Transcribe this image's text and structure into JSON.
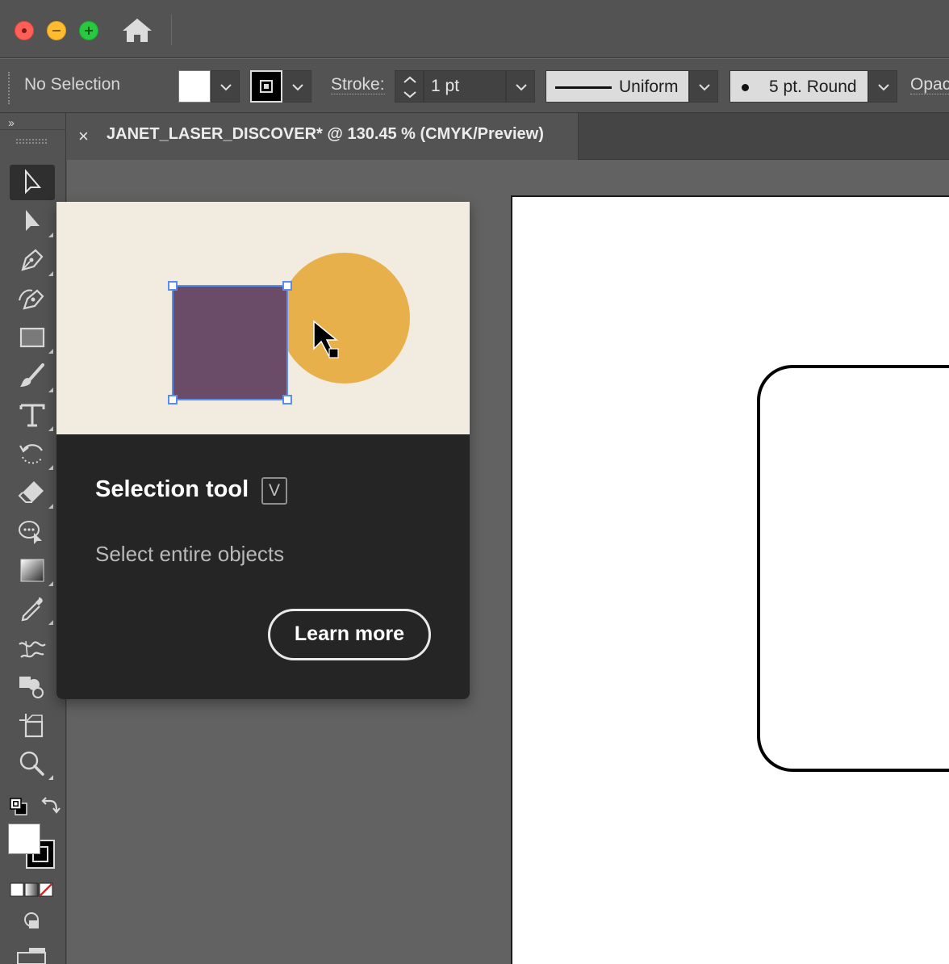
{
  "window": {
    "home_icon": "home-icon"
  },
  "control_bar": {
    "selection_status": "No Selection",
    "fill_color": "#ffffff",
    "stroke_label": "Stroke:",
    "stroke_weight": "1 pt",
    "variable_width_profile": "Uniform",
    "brush_definition": "5 pt. Round",
    "opacity_label": "Opac"
  },
  "document_tab": {
    "close_glyph": "×",
    "title": "JANET_LASER_DISCOVER* @ 130.45 % (CMYK/Preview)"
  },
  "toolbar": {
    "collapse_glyph": "››",
    "tools": [
      {
        "name": "selection-tool",
        "icon": "selection-arrow-icon",
        "active": true
      },
      {
        "name": "direct-selection-tool",
        "icon": "direct-selection-arrow-icon"
      },
      {
        "name": "pen-tool",
        "icon": "pen-icon"
      },
      {
        "name": "curvature-tool",
        "icon": "curvature-pen-icon"
      },
      {
        "name": "rectangle-tool",
        "icon": "rectangle-icon"
      },
      {
        "name": "paintbrush-tool",
        "icon": "paintbrush-icon"
      },
      {
        "name": "type-tool",
        "icon": "type-icon"
      },
      {
        "name": "rotate-tool",
        "icon": "rotate-icon"
      },
      {
        "name": "eraser-tool",
        "icon": "eraser-icon"
      },
      {
        "name": "puppet-warp-tool",
        "icon": "puppet-warp-icon"
      },
      {
        "name": "gradient-tool",
        "icon": "gradient-icon"
      },
      {
        "name": "eyedropper-tool",
        "icon": "eyedropper-icon"
      },
      {
        "name": "blend-tool",
        "icon": "blend-icon"
      },
      {
        "name": "shape-builder-tool",
        "icon": "shape-builder-icon"
      },
      {
        "name": "artboard-tool",
        "icon": "artboard-icon"
      },
      {
        "name": "zoom-tool",
        "icon": "zoom-icon"
      }
    ],
    "default_fill_color": "#ffffff",
    "default_stroke_color": "#000000"
  },
  "tooltip": {
    "title": "Selection tool",
    "shortcut": "V",
    "description": "Select entire objects",
    "learn_more_label": "Learn more",
    "illustration_colors": {
      "background": "#f2ebe0",
      "square": "#6a4c68",
      "circle": "#e8b04b",
      "selection_handles": "#5a8df0"
    }
  },
  "colors": {
    "chrome": "#535353",
    "canvas": "#626262",
    "tooltip_bg": "#252525"
  }
}
